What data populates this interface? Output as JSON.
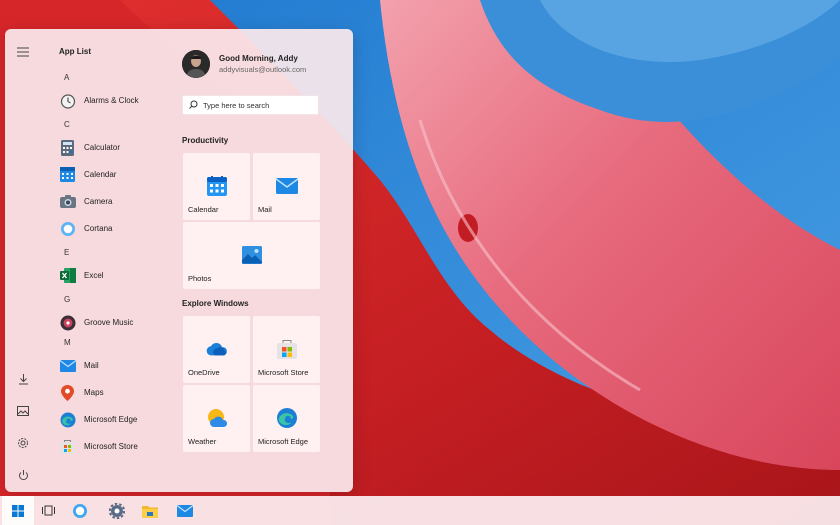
{
  "start_menu": {
    "app_list_title": "App List",
    "groups": [
      {
        "letter": "A",
        "apps": [
          {
            "label": "Alarms & Clock",
            "icon": "alarm-clock-icon"
          }
        ]
      },
      {
        "letter": "C",
        "apps": [
          {
            "label": "Calculator",
            "icon": "calculator-icon"
          },
          {
            "label": "Calendar",
            "icon": "calendar-icon"
          },
          {
            "label": "Camera",
            "icon": "camera-icon"
          },
          {
            "label": "Cortana",
            "icon": "cortana-icon"
          }
        ]
      },
      {
        "letter": "E",
        "apps": [
          {
            "label": "Excel",
            "icon": "excel-icon"
          }
        ]
      },
      {
        "letter": "G",
        "apps": [
          {
            "label": "Groove Music",
            "icon": "groove-music-icon"
          }
        ]
      },
      {
        "letter": "M",
        "apps": [
          {
            "label": "Mail",
            "icon": "mail-icon"
          },
          {
            "label": "Maps",
            "icon": "maps-icon"
          },
          {
            "label": "Microsoft Edge",
            "icon": "edge-icon"
          },
          {
            "label": "Microsoft Store",
            "icon": "store-icon"
          }
        ]
      }
    ],
    "user": {
      "greeting": "Good Morning, Addy",
      "email": "addyvisuals@outlook.com"
    },
    "search": {
      "placeholder": "Type here to search"
    },
    "productivity": {
      "title": "Productivity",
      "tiles": [
        {
          "label": "Calendar",
          "icon": "calendar-icon"
        },
        {
          "label": "Mail",
          "icon": "mail-icon"
        },
        {
          "label": "Photos",
          "icon": "photos-icon"
        }
      ]
    },
    "explore": {
      "title": "Explore Windows",
      "tiles": [
        {
          "label": "OneDrive",
          "icon": "onedrive-icon"
        },
        {
          "label": "Microsoft Store",
          "icon": "store-icon"
        },
        {
          "label": "Weather",
          "icon": "weather-icon"
        },
        {
          "label": "Microsoft Edge",
          "icon": "edge-icon"
        }
      ]
    },
    "rail_icons": [
      "hamburger-menu-icon",
      "downloads-icon",
      "pictures-icon",
      "settings-gear-icon",
      "power-icon"
    ]
  },
  "taskbar": {
    "items": [
      "windows-start-icon",
      "task-view-icon",
      "cortana-icon",
      "settings-gear-icon",
      "file-explorer-icon",
      "mail-icon"
    ]
  },
  "colors": {
    "accent": "#0a78d4",
    "menu_bg": "#f9e7eb",
    "wallpaper_red": "#e23a3a",
    "sky_blue": "#2f86d2"
  }
}
